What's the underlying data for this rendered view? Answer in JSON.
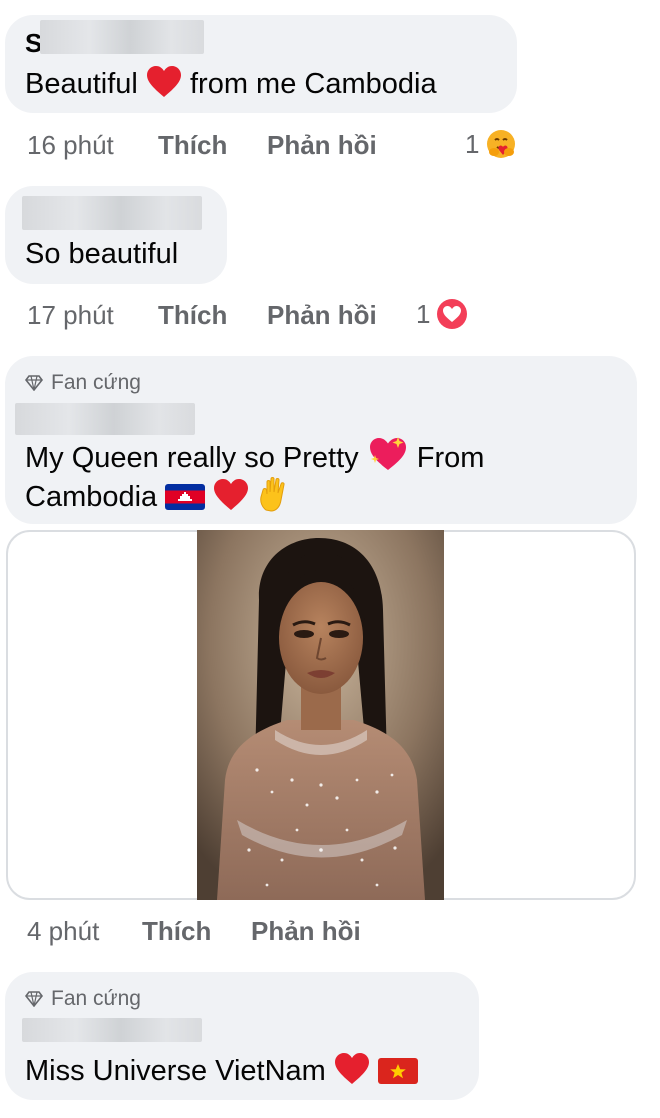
{
  "comments": [
    {
      "name_initial": "S",
      "text_before": "Beautiful",
      "text_after": "from me Cambodia",
      "time": "16 phút",
      "like_label": "Thích",
      "reply_label": "Phản hồi",
      "reaction_count": "1",
      "reaction_icon": "hug-emoji-icon"
    },
    {
      "text": "So beautiful",
      "time": "17 phút",
      "like_label": "Thích",
      "reply_label": "Phản hồi",
      "reaction_count": "1",
      "reaction_icon": "love-reaction-icon"
    },
    {
      "badge": "Fan cứng",
      "text_line1_before": "My Queen really so Pretty",
      "text_line1_after": "From",
      "text_line2": "Cambodia",
      "time": "4 phút",
      "like_label": "Thích",
      "reply_label": "Phản hồi",
      "photo": "portrait-photo"
    },
    {
      "badge": "Fan cứng",
      "text": "Miss Universe VietNam"
    }
  ],
  "colors": {
    "bubble": "#f0f2f5",
    "meta_text": "#65676b",
    "heart": "#e5202e",
    "love_reaction": "#f33e58"
  }
}
